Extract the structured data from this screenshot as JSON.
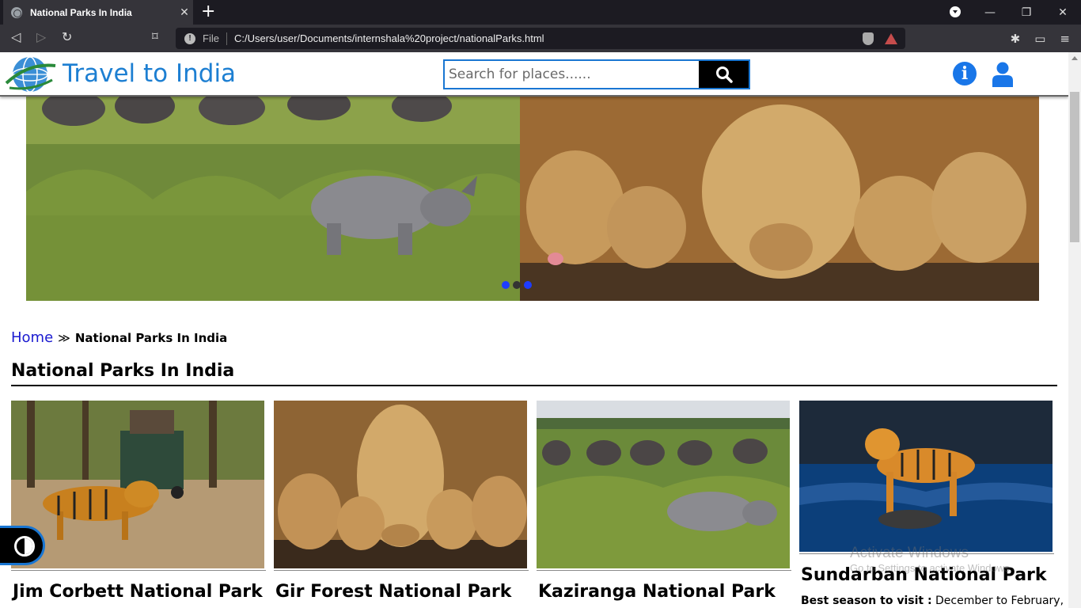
{
  "browser": {
    "tab_title": "National Parks In India",
    "url_scheme_label": "File",
    "url": "C:/Users/user/Documents/internshala%20project/nationalParks.html"
  },
  "header": {
    "site_title": "Travel to India",
    "search_placeholder": "Search for places......"
  },
  "breadcrumb": {
    "home": "Home",
    "separator": "≫",
    "current": "National Parks In India"
  },
  "section_title": "National Parks In India",
  "cards": [
    {
      "title": "Jim Corbett National Park"
    },
    {
      "title": "Gir Forest National Park"
    },
    {
      "title": "Kaziranga National Park"
    },
    {
      "title": "Sundarban National Park",
      "info_label": "Best season to visit :",
      "info_value": "December to February,"
    }
  ],
  "watermark": {
    "line1": "Activate Windows",
    "line2": "Go to Settings to activate Windows."
  },
  "colors": {
    "accent": "#1976d2",
    "title_blue": "#1d7fd2",
    "link_blue": "#1a1ad0"
  }
}
